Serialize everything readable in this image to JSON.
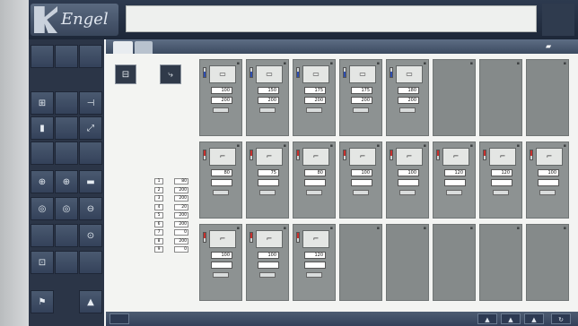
{
  "app": {
    "logo_text": "Engel"
  },
  "message_bar": {
    "text": ""
  },
  "status": {
    "lines": [
      "",
      "",
      ""
    ]
  },
  "header": {
    "icon": "settings-icon"
  },
  "icons": {
    "left_column": [
      "home-icon",
      "mold-icon",
      "injection-icon",
      "screw-icon",
      "core-icon",
      "ejector-icon",
      "robot-icon",
      "heat-icon",
      "temp-icon",
      "cycle-icon",
      "lock-icon",
      "alarm-icon"
    ]
  },
  "axes": {
    "title": "",
    "rows": [
      {
        "name": "",
        "pos": "1",
        "value": "80"
      },
      {
        "name": "",
        "pos": "2",
        "value": "200"
      },
      {
        "name": "",
        "pos": "3",
        "value": "200"
      },
      {
        "name": "",
        "pos": "4",
        "value": "20"
      },
      {
        "name": "",
        "pos": "5",
        "value": "200"
      },
      {
        "name": "",
        "pos": "6",
        "value": "200"
      },
      {
        "name": "",
        "pos": "7",
        "value": "0"
      },
      {
        "name": "",
        "pos": "8",
        "value": "200"
      },
      {
        "name": "",
        "pos": "9",
        "value": "0"
      }
    ]
  },
  "tiles_row1": [
    {
      "v1": "100",
      "v2": "200"
    },
    {
      "v1": "150",
      "v2": "200"
    },
    {
      "v1": "175",
      "v2": "200"
    },
    {
      "v1": "175",
      "v2": "200"
    },
    {
      "v1": "180",
      "v2": "200"
    }
  ],
  "tiles_row2": [
    {
      "v1": "80",
      "v2": ""
    },
    {
      "v1": "75",
      "v2": ""
    },
    {
      "v1": "80",
      "v2": ""
    },
    {
      "v1": "100",
      "v2": ""
    },
    {
      "v1": "100",
      "v2": ""
    },
    {
      "v1": "120",
      "v2": ""
    },
    {
      "v1": "120",
      "v2": ""
    },
    {
      "v1": "100",
      "v2": ""
    }
  ],
  "tiles_row3": [
    {
      "v1": "100",
      "v2": ""
    },
    {
      "v1": "100",
      "v2": ""
    },
    {
      "v1": "120",
      "v2": ""
    }
  ],
  "footer": {
    "buttons": [
      "▲",
      "▲",
      "▲",
      "↻"
    ]
  }
}
